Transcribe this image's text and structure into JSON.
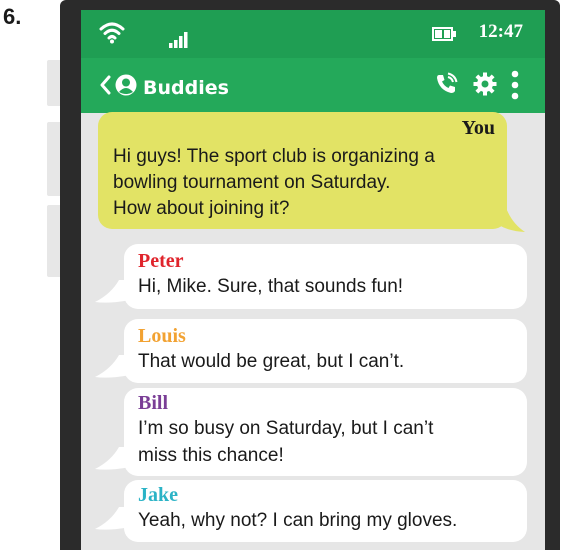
{
  "question_number": "6.",
  "status_bar": {
    "time": "12:47",
    "wifi_icon": "wifi-icon",
    "signal_icon": "signal-bars-icon",
    "battery_icon": "battery-icon"
  },
  "app_bar": {
    "title": "Buddies",
    "back_icon": "chevron-left-icon",
    "avatar_icon": "person-icon",
    "call_icon": "phone-call-icon",
    "settings_icon": "gear-icon",
    "menu_icon": "more-vert-icon"
  },
  "colors": {
    "status_bar": "#1f9e53",
    "app_bar": "#24a95a",
    "you_bubble": "#e2e365",
    "peter": "#e0242c",
    "louis": "#f2a232",
    "bill": "#7a3e96",
    "jake": "#2bb3c6"
  },
  "messages": [
    {
      "sender": "You",
      "lines": [
        "Hi guys! The sport club is organizing a",
        "bowling tournament on Saturday.",
        "How about joining it?"
      ]
    },
    {
      "sender": "Peter",
      "lines": [
        "Hi, Mike. Sure, that sounds fun!"
      ]
    },
    {
      "sender": "Louis",
      "lines": [
        "That would be great, but I can’t."
      ]
    },
    {
      "sender": "Bill",
      "lines": [
        "I’m so busy on Saturday, but I can’t",
        "miss this chance!"
      ]
    },
    {
      "sender": "Jake",
      "lines": [
        "Yeah, why not? I can bring my gloves."
      ]
    }
  ]
}
